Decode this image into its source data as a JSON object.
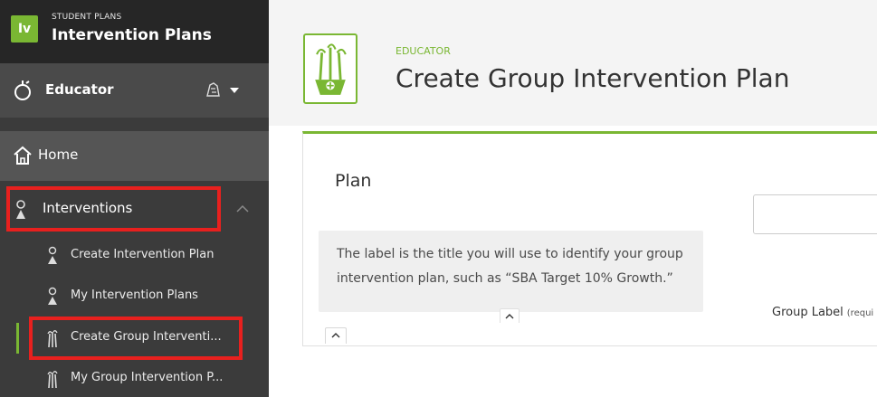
{
  "app": {
    "logo_text": "Iv",
    "subtitle": "STUDENT PLANS",
    "title": "Intervention Plans"
  },
  "sidebar": {
    "role": {
      "label": "Educator"
    },
    "home": {
      "label": "Home"
    },
    "interventions": {
      "label": "Interventions",
      "children": [
        {
          "label": "Create Intervention Plan"
        },
        {
          "label": "My Intervention Plans"
        },
        {
          "label": "Create Group Interventi..."
        },
        {
          "label": "My Group Intervention P..."
        }
      ]
    }
  },
  "page": {
    "eyebrow": "EDUCATOR",
    "title": "Create Group Intervention Plan"
  },
  "plan_section": {
    "title": "Plan",
    "help_text": "The label is the title you will use to identify your group intervention plan, such as “SBA Target 10% Growth.”"
  },
  "form": {
    "group_label": {
      "label": "Group Label",
      "required_text": "(requi",
      "value": ""
    }
  },
  "colors": {
    "accent": "#7ab733",
    "highlight_box": "#e8201e",
    "sidebar_bg": "#3b3b3b"
  }
}
